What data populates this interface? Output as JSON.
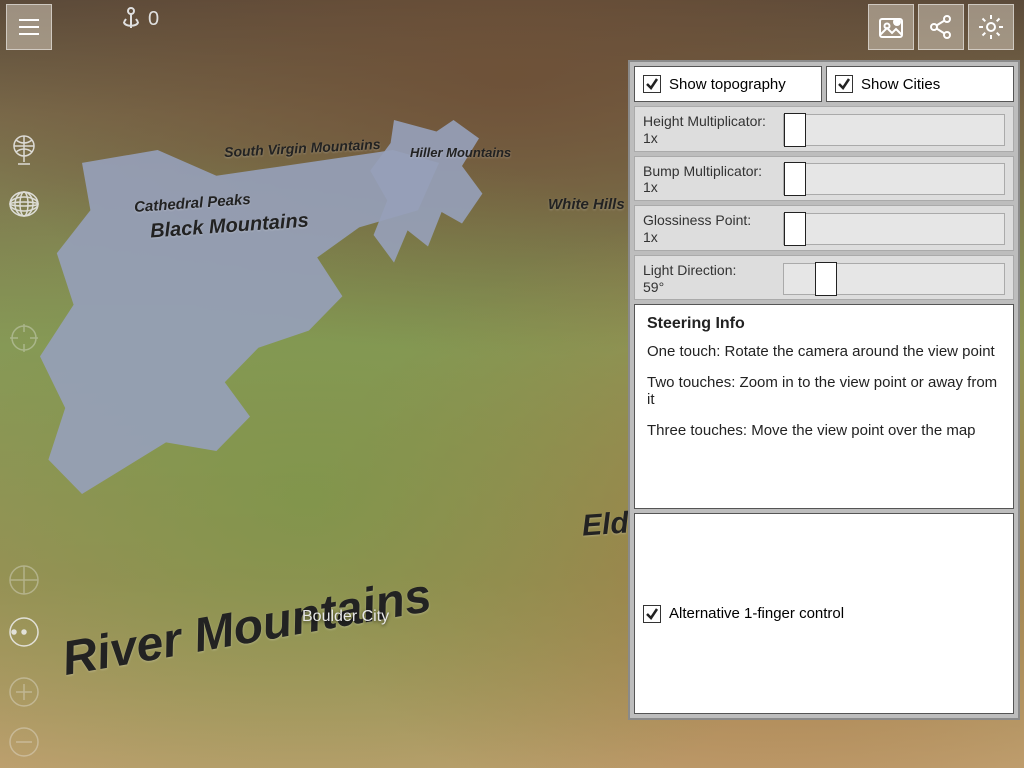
{
  "heading_value": "0",
  "map_labels": {
    "river_mountains": "River Mountains",
    "black_mountains": "Black Mountains",
    "cathedral_peaks": "Cathedral Peaks",
    "south_virgin": "South Virgin Mountains",
    "hiller": "Hiller Mountains",
    "white_hills": "White Hills",
    "eldorado_partial": "Eld",
    "boulder_city": "Boulder City"
  },
  "checkboxes": {
    "show_topography": "Show topography",
    "show_cities": "Show Cities",
    "alt_control": "Alternative 1-finger control"
  },
  "sliders": {
    "height": {
      "label": "Height Multiplicator:",
      "value": "1x",
      "pos": 0
    },
    "bump": {
      "label": "Bump Multiplicator:",
      "value": "1x",
      "pos": 0
    },
    "gloss": {
      "label": "Glossiness Point:",
      "value": "1x",
      "pos": 0
    },
    "light": {
      "label": "Light Direction:",
      "value": "59°",
      "pos": 14
    }
  },
  "info": {
    "title": "Steering Info",
    "one": "One touch: Rotate the camera around the view point",
    "two": "Two touches: Zoom in to the view point or away from it",
    "three": "Three touches: Move the view point over the map"
  }
}
